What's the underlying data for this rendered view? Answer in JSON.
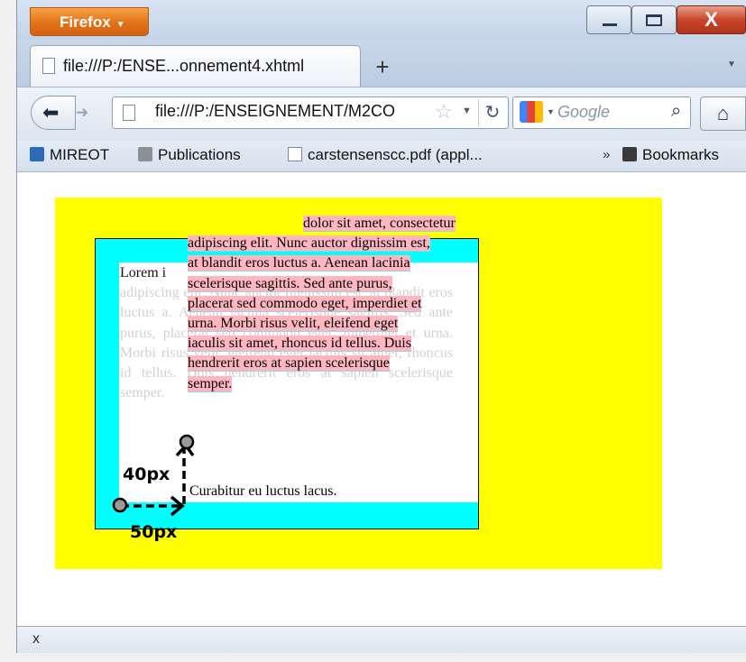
{
  "window": {
    "menu_button_label": "Firefox",
    "close_glyph": "X"
  },
  "tabs": [
    {
      "title": "file:///P:/ENSE...onnement4.xhtml"
    }
  ],
  "new_tab_glyph": "+",
  "navbar": {
    "url": "file:///P:/ENSEIGNEMENT/M2CO",
    "search_placeholder": "Google"
  },
  "bookmarks": {
    "items": [
      {
        "label": "MIREOT",
        "icon": "page-icon"
      },
      {
        "label": "Publications",
        "icon": "page-icon"
      },
      {
        "label": "carstensenscc.pdf (appl...",
        "icon": "document-icon"
      }
    ],
    "overflow_glyph": "»",
    "menu_label": "Bookmarks"
  },
  "page": {
    "background_color": "#ffff00",
    "box_color": "#00ffff",
    "highlight_color": "#ffb6c1",
    "ghost_first_word": "Lorem i",
    "ghost_text": "adipiscing elit. Nunc auctor dignissim est, at blandit eros luctus a. Aenean lacinia scelerisque sagittis. Sed ante purus, placerat sed commodo eget, imperdiet et urna. Morbi risus velit, eleifend eget iaculis sit amet, rhoncus id tellus. Duis hendrerit eros at sapien scelerisque semper.",
    "shifted_lines": [
      "dolor sit amet, consectetur",
      "adipiscing elit. Nunc auctor dignissim est,",
      "at blandit eros luctus a. Aenean lacinia",
      "scelerisque sagittis. Sed ante purus,",
      "placerat sed commodo eget, imperdiet et",
      "urna. Morbi risus velit, eleifend eget",
      "iaculis sit amet, rhoncus id tellus. Duis",
      "hendrerit eros at sapien scelerisque",
      "semper."
    ],
    "last_line": "Curabitur eu luctus lacus."
  },
  "annotations": {
    "vertical_offset": "40px",
    "horizontal_offset": "50px"
  },
  "statusbar": {
    "close_glyph": "x"
  }
}
